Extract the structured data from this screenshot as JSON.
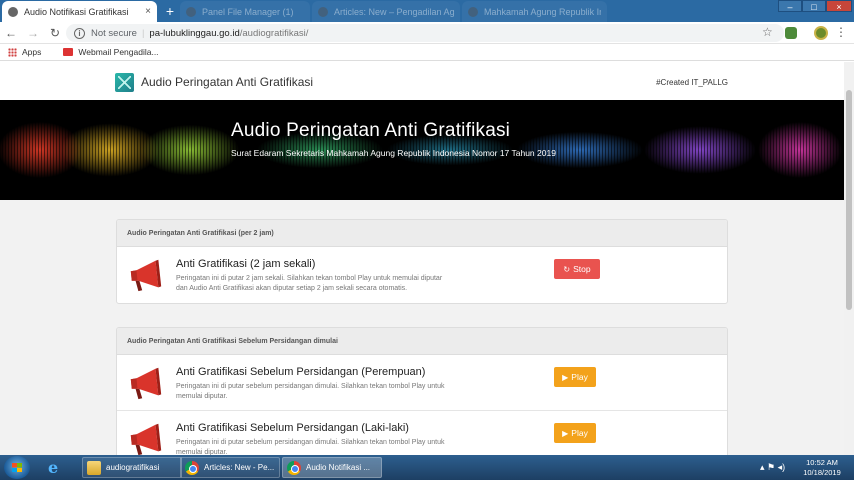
{
  "browser": {
    "tabs": [
      {
        "label": "Audio Notifikasi Gratifikasi",
        "active": true
      },
      {
        "label": "Panel File Manager (1)",
        "active": false
      },
      {
        "label": "Articles: New – Pengadilan Agam",
        "active": false
      },
      {
        "label": "Mahkamah Agung Republik Indo",
        "active": false
      }
    ],
    "close_glyph": "×",
    "new_tab_glyph": "+",
    "window_controls": {
      "minimize": "–",
      "maximize": "□",
      "close": "×"
    },
    "address": {
      "security": "Not secure",
      "host": "pa-lubuklinggau.go.id",
      "path": "/audiogratifikasi/"
    },
    "bookmarks": [
      {
        "label": "Apps"
      },
      {
        "label": "Webmail Pengadila..."
      }
    ]
  },
  "site": {
    "title": "Audio Peringatan Anti Gratifikasi",
    "credit": "#Created IT_PALLG"
  },
  "banner": {
    "title": "Audio Peringatan Anti Gratifikasi",
    "subtitle": "Surat Edaram Sekretaris Mahkamah Agung Republik Indonesia Nomor 17 Tahun 2019"
  },
  "sections": [
    {
      "heading": "Audio Peringatan Anti Gratifikasi (per 2 jam)",
      "items": [
        {
          "title": "Anti Gratifikasi (2 jam sekali)",
          "description": "Peringatan ini di putar 2 jam sekali. Silahkan tekan tombol Play untuk memulai diputar dan Audio Anti Gratifikasi akan diputar setiap 2 jam sekali secara otomatis.",
          "button_label": "Stop",
          "button_icon": "↻"
        }
      ]
    },
    {
      "heading": "Audio Peringatan Anti Gratifikasi Sebelum Persidangan dimulai",
      "items": [
        {
          "title": "Anti Gratifikasi Sebelum Persidangan (Perempuan)",
          "description": "Peringatan ini di putar sebelum persidangan dimulai. Silahkan tekan tombol Play untuk memulai diputar.",
          "button_label": "Play",
          "button_icon": "▶"
        },
        {
          "title": "Anti Gratifikasi Sebelum Persidangan (Laki-laki)",
          "description": "Peringatan ini di putar sebelum persidangan dimulai. Silahkan tekan tombol Play untuk memulai diputar.",
          "button_label": "Play",
          "button_icon": "▶"
        }
      ]
    }
  ],
  "taskbar": {
    "items": [
      {
        "label": "audiogratifikasi"
      },
      {
        "label": "Articles: New - Pe..."
      },
      {
        "label": "Audio Notifikasi ..."
      }
    ],
    "time": "10:52 AM",
    "date": "10/18/2019"
  },
  "colors": {
    "stop_button": "#e9534f",
    "play_button": "#f3a21b",
    "tab_bar": "#2b6aa3"
  }
}
